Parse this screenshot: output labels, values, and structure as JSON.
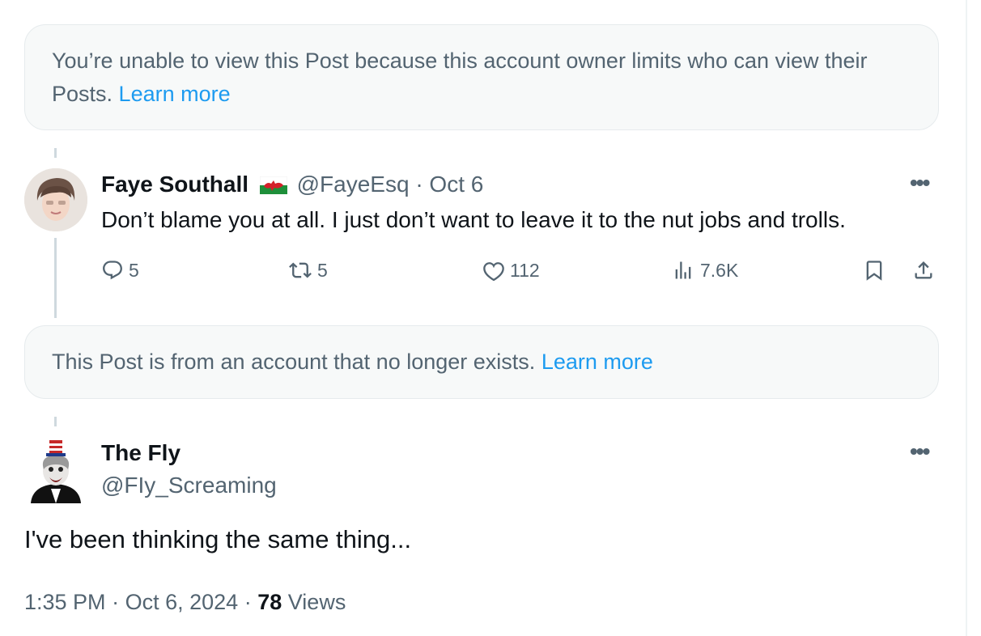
{
  "notice_restricted": {
    "text": "You’re unable to view this Post because this account owner limits who can view their Posts.",
    "link": "Learn more"
  },
  "reply": {
    "name": "Faye Southall",
    "flag": "welsh-flag-icon",
    "handle": "@FayeEsq",
    "sep": "·",
    "date": "Oct 6",
    "text": "Don’t blame you at all. I just don’t want to leave it to the nut jobs and trolls.",
    "actions": {
      "replies": "5",
      "reposts": "5",
      "likes": "112",
      "views": "7.6K"
    }
  },
  "notice_deleted": {
    "text": "This Post is from an account that no longer exists.",
    "link": "Learn more"
  },
  "main_post": {
    "name": "The Fly",
    "handle": "@FIy_Screaming",
    "text": "I've been thinking the same thing...",
    "time": "1:35 PM",
    "date": "Oct 6, 2024",
    "views_count": "78",
    "views_label": "Views",
    "sep": "·"
  },
  "colors": {
    "accent": "#1d9bf0",
    "muted": "#536471",
    "text": "#0f1419",
    "notice_bg": "#f7f9f9"
  }
}
